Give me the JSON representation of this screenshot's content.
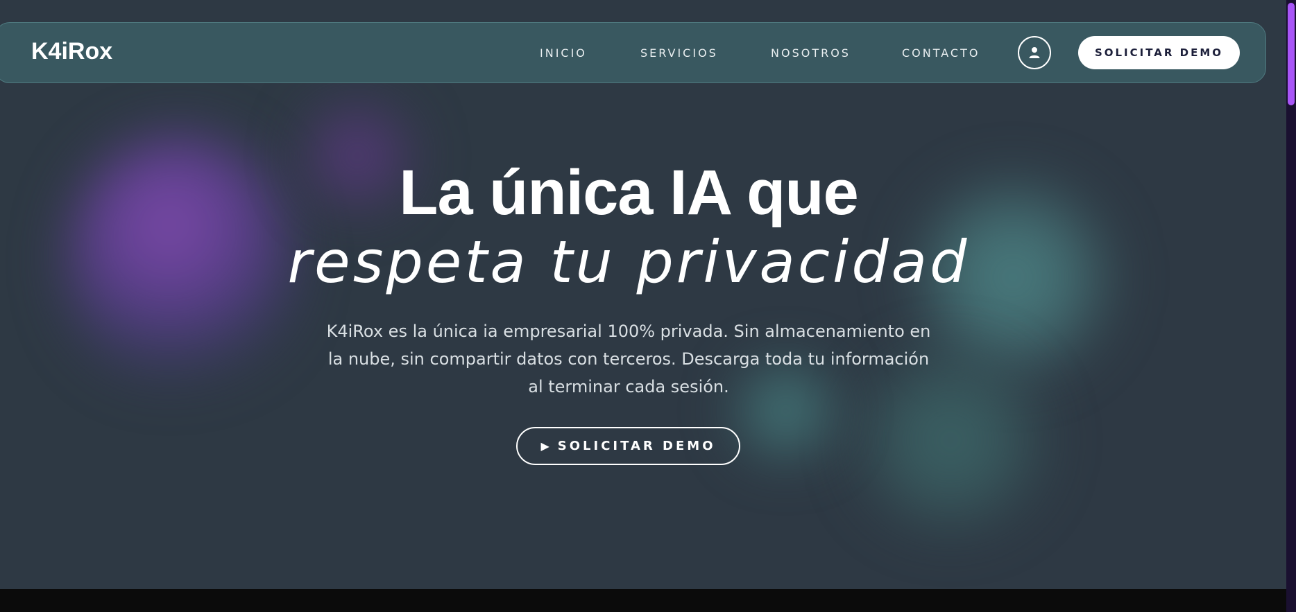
{
  "brand": {
    "logo_text": "K4iRox"
  },
  "nav": {
    "links": [
      "INICIO",
      "SERVICIOS",
      "NOSOTROS",
      "CONTACTO"
    ],
    "user_icon": "user-icon",
    "demo_label": "SOLICITAR DEMO"
  },
  "hero": {
    "headline": "La única IA que",
    "subline": "respeta tu privacidad",
    "description": "K4iRox es la única ia empresarial 100% privada. Sin almacenamiento en la nube, sin compartir datos con terceros. Descarga toda tu información al terminar cada sesión.",
    "cta_icon": "play-icon",
    "cta_label": "SOLICITAR DEMO"
  },
  "colors": {
    "hero_bg": "#2e3944",
    "navbar_bg": "#395860",
    "accent_purple": "#a855f7",
    "button_text": "#1c1f3a"
  }
}
